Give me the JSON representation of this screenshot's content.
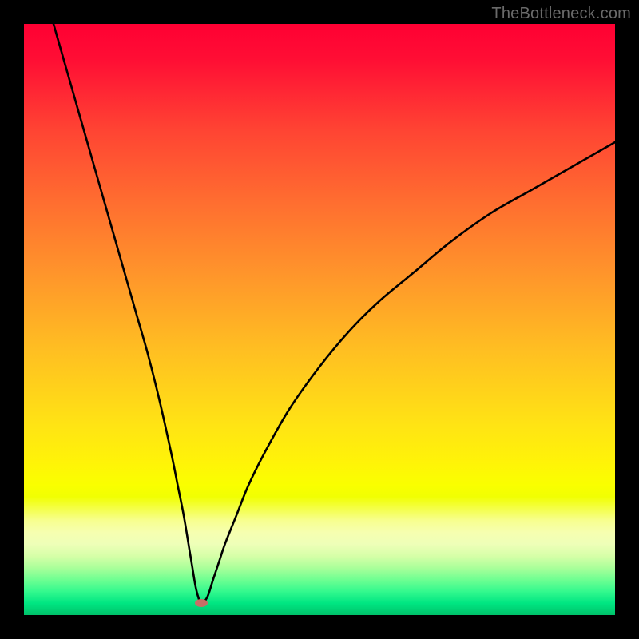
{
  "watermark": "TheBottleneck.com",
  "chart_data": {
    "type": "line",
    "title": "",
    "xlabel": "",
    "ylabel": "",
    "xlim": [
      0,
      100
    ],
    "ylim": [
      0,
      100
    ],
    "grid": false,
    "series": [
      {
        "name": "bottleneck-curve",
        "x": [
          5,
          7,
          9,
          11,
          13,
          15,
          17,
          19,
          21,
          23,
          25,
          26,
          27,
          28,
          28.5,
          29,
          29.5,
          30,
          31,
          32,
          33,
          34,
          36,
          38,
          41,
          45,
          50,
          55,
          60,
          66,
          72,
          79,
          86,
          93,
          100
        ],
        "y": [
          100,
          93,
          86,
          79,
          72,
          65,
          58,
          51,
          44,
          36,
          27,
          22,
          17,
          11,
          8,
          5,
          3,
          2,
          3,
          6,
          9,
          12,
          17,
          22,
          28,
          35,
          42,
          48,
          53,
          58,
          63,
          68,
          72,
          76,
          80
        ]
      }
    ],
    "annotations": [
      {
        "name": "optimal-point",
        "x": 30,
        "y": 2,
        "color": "#c76f66"
      }
    ],
    "background_gradient": {
      "stops": [
        {
          "pos": 0.0,
          "color": "#ff0033"
        },
        {
          "pos": 0.06,
          "color": "#ff0e34"
        },
        {
          "pos": 0.18,
          "color": "#ff4433"
        },
        {
          "pos": 0.3,
          "color": "#ff6d30"
        },
        {
          "pos": 0.42,
          "color": "#ff942b"
        },
        {
          "pos": 0.55,
          "color": "#ffbe22"
        },
        {
          "pos": 0.68,
          "color": "#ffe414"
        },
        {
          "pos": 0.74,
          "color": "#fff308"
        },
        {
          "pos": 0.78,
          "color": "#faff00"
        },
        {
          "pos": 0.8,
          "color": "#f1ff02"
        },
        {
          "pos": 0.84,
          "color": "#f7ff8f"
        },
        {
          "pos": 0.86,
          "color": "#f6ffb0"
        },
        {
          "pos": 0.88,
          "color": "#eeffb8"
        },
        {
          "pos": 0.9,
          "color": "#d6ffa8"
        },
        {
          "pos": 0.92,
          "color": "#aaff9a"
        },
        {
          "pos": 0.94,
          "color": "#6fff92"
        },
        {
          "pos": 0.96,
          "color": "#34f98e"
        },
        {
          "pos": 0.98,
          "color": "#00e682"
        },
        {
          "pos": 1.0,
          "color": "#00c26a"
        }
      ]
    }
  }
}
